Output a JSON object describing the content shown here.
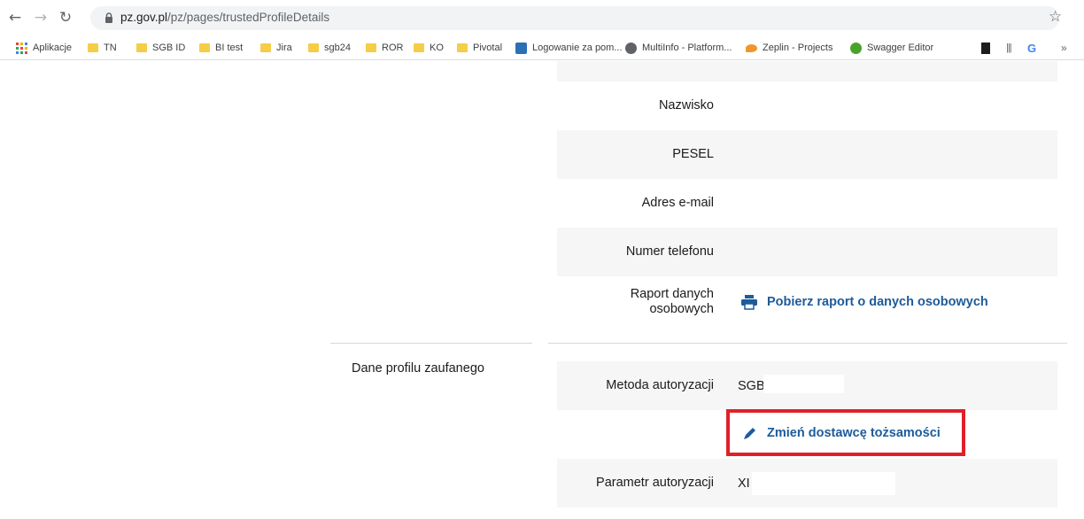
{
  "browser": {
    "url_host": "pz.gov.pl",
    "url_path": "/pz/pages/trustedProfileDetails",
    "bookmarks": [
      {
        "label": "Aplikacje",
        "icon": "apps-grid-icon",
        "color": "#e8453c"
      },
      {
        "label": "TN",
        "icon": "folder-icon"
      },
      {
        "label": "SGB ID",
        "icon": "folder-icon"
      },
      {
        "label": "BI test",
        "icon": "folder-icon"
      },
      {
        "label": "Jira",
        "icon": "folder-icon"
      },
      {
        "label": "sgb24",
        "icon": "folder-icon"
      },
      {
        "label": "ROR",
        "icon": "folder-icon"
      },
      {
        "label": "KO",
        "icon": "folder-icon"
      },
      {
        "label": "Pivotal",
        "icon": "folder-icon"
      },
      {
        "label": "Logowanie za pom...",
        "icon": "site-icon",
        "color": "#2d6fb3"
      },
      {
        "label": "MultiInfo - Platform...",
        "icon": "globe-icon",
        "color": "#5f6368"
      },
      {
        "label": "Zeplin - Projects",
        "icon": "zeplin-icon",
        "color": "#f0962b"
      },
      {
        "label": "Swagger Editor",
        "icon": "swagger-icon",
        "color": "#49a32b"
      }
    ]
  },
  "personal_rows": [
    {
      "label": "Nazwisko",
      "value": ""
    },
    {
      "label": "PESEL",
      "value": ""
    },
    {
      "label": "Adres e-mail",
      "value": ""
    },
    {
      "label": "Numer telefonu",
      "value": ""
    },
    {
      "label_line1": "Raport danych",
      "label_line2": "osobowych"
    }
  ],
  "report_link": {
    "label": "Pobierz raport o danych osobowych",
    "icon": "printer-icon"
  },
  "profile_section": {
    "title": "Dane profilu zaufanego",
    "auth_method_label": "Metoda autoryzacji",
    "auth_method_value": "SGB",
    "change_provider_link": "Zmień dostawcę tożsamości",
    "change_provider_icon": "pencil-icon",
    "auth_param_label": "Parametr autoryzacji",
    "auth_param_value": "XI"
  },
  "colors": {
    "link": "#1d5b9a",
    "highlight": "#e0202a",
    "row_shade": "#f6f6f6"
  }
}
